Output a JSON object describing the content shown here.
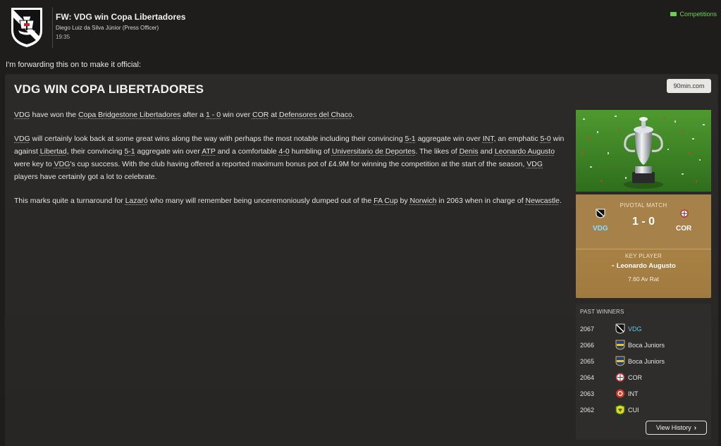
{
  "header": {
    "title": "FW: VDG win Copa Libertadores",
    "sender": "Diego Luiz da Silva Júnior  (Press Officer)",
    "time": "19:35",
    "competitions_link": "Competitions"
  },
  "intro": "I'm forwarding this on to make it official:",
  "article": {
    "title": "VDG WIN COPA LIBERTADORES",
    "source": "90min.com",
    "p1": {
      "t1": "VDG",
      "t2": " have won the ",
      "t3": "Copa Bridgestone Libertadores",
      "t4": " after a ",
      "t5": "1 - 0",
      "t6": " win over ",
      "t7": "COR",
      "t8": " at ",
      "t9": "Defensores del Chaco",
      "t10": "."
    },
    "p2": {
      "t1": "VDG",
      "t2": " will certainly look back at some great wins along the way with perhaps the most notable including their convincing ",
      "t3": "5-1",
      "t4": " aggregate win over ",
      "t5": "INT",
      "t6": ", an emphatic ",
      "t7": "5-0",
      "t8": " win against ",
      "t9": "Libertad",
      "t10": ", their convincing ",
      "t11": "5-1",
      "t12": " aggregate win over ",
      "t13": "ATP",
      "t14": " and a comfortable ",
      "t15": "4-0",
      "t16": " humbling of ",
      "t17": "Universitario de Deportes",
      "t18": ". The likes of ",
      "t19": "Denis",
      "t20": " and ",
      "t21": "Leonardo Augusto",
      "t22": " were key to ",
      "t23": "VDG",
      "t24": "'s cup success. With the club having offered a reported maximum bonus pot of £4.9M for winning the competition at the start of the season, ",
      "t25": "VDG",
      "t26": " players have certainly got a lot to celebrate."
    },
    "p3": {
      "t1": "This marks quite a turnaround for ",
      "t2": "Lazaró",
      "t3": " who many will remember being unceremoniously dumped out of the ",
      "t4": "FA Cup",
      "t5": " by ",
      "t6": "Norwich",
      "t7": " in 2063 when in charge of ",
      "t8": "Newcastle",
      "t9": "."
    }
  },
  "pivotal_match": {
    "label": "PIVOTAL MATCH",
    "home": "VDG",
    "away": "COR",
    "score": "1 - 0"
  },
  "key_player": {
    "label": "KEY PLAYER",
    "name": "Leonardo Augusto",
    "rating": "7.60 Av Rat"
  },
  "past_winners": {
    "title": "PAST WINNERS",
    "rows": [
      {
        "year": "2067",
        "team": "VDG",
        "badge": "vasco-badge-icon"
      },
      {
        "year": "2066",
        "team": "Boca Juniors",
        "badge": "boca-badge-icon"
      },
      {
        "year": "2065",
        "team": "Boca Juniors",
        "badge": "boca-badge-icon"
      },
      {
        "year": "2064",
        "team": "COR",
        "badge": "corinthians-badge-icon"
      },
      {
        "year": "2063",
        "team": "INT",
        "badge": "internacional-badge-icon"
      },
      {
        "year": "2062",
        "team": "CUI",
        "badge": "cuiaba-badge-icon"
      }
    ],
    "history_button": "View History"
  },
  "colors": {
    "background": "#1f1d1c",
    "panel": "#2c2a29",
    "gold_panel": "#a6824a",
    "link_green": "#6fcf4f",
    "highlight_blue": "#5ec8f2"
  }
}
